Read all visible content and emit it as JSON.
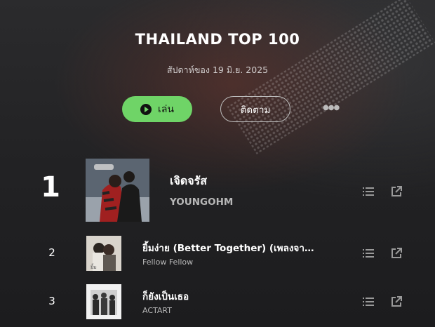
{
  "chart": {
    "title": "THAILAND TOP 100",
    "week_label": "สัปดาห์ของ 19 มิ.ย. 2025"
  },
  "actions": {
    "play_label": "เล่น",
    "follow_label": "ติดตาม"
  },
  "tracks": [
    {
      "rank": "1",
      "title": "เจิดจรัส",
      "artist": "YOUNGOHM"
    },
    {
      "rank": "2",
      "title": "ยิ้มง่าย (Better Together) (เพลงจาก...",
      "artist": "Fellow Fellow"
    },
    {
      "rank": "3",
      "title": "ก็ยังเป็นเธอ",
      "artist": "ACTART"
    }
  ],
  "colors": {
    "accent": "#6fd467",
    "background": "#232325"
  },
  "icons": [
    "play-icon",
    "more-icon",
    "queue-icon",
    "share-icon"
  ]
}
